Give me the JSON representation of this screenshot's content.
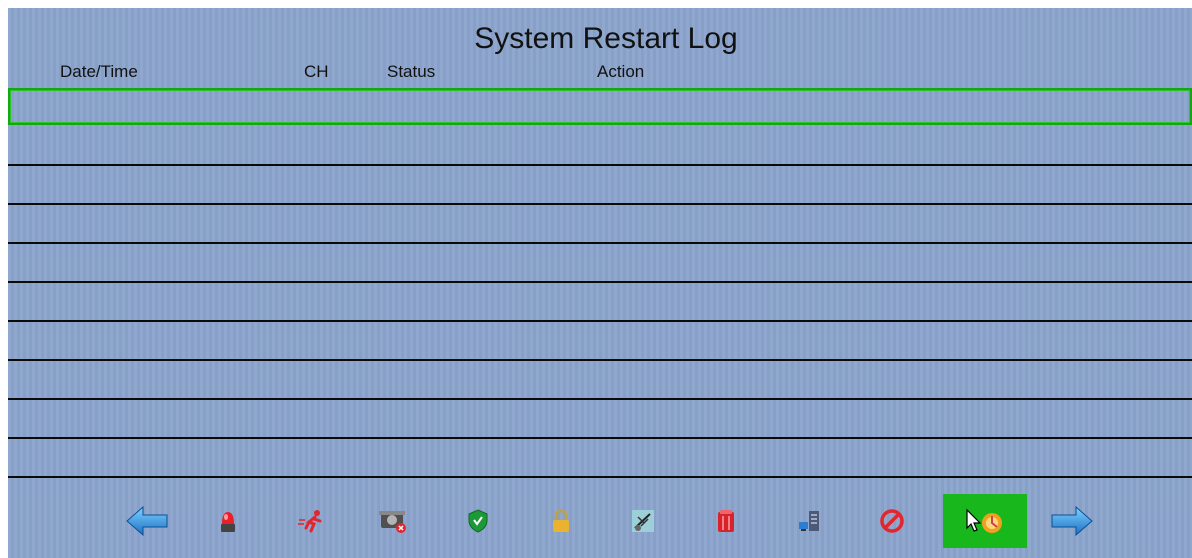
{
  "screen": {
    "title": "System Restart Log"
  },
  "table": {
    "columns": {
      "datetime": "Date/Time",
      "ch": "CH",
      "status": "Status",
      "action": "Action"
    },
    "rows": [
      {
        "datetime": "",
        "ch": "",
        "status": "",
        "action": ""
      },
      {
        "datetime": "",
        "ch": "",
        "status": "",
        "action": ""
      },
      {
        "datetime": "",
        "ch": "",
        "status": "",
        "action": ""
      },
      {
        "datetime": "",
        "ch": "",
        "status": "",
        "action": ""
      },
      {
        "datetime": "",
        "ch": "",
        "status": "",
        "action": ""
      },
      {
        "datetime": "",
        "ch": "",
        "status": "",
        "action": ""
      },
      {
        "datetime": "",
        "ch": "",
        "status": "",
        "action": ""
      },
      {
        "datetime": "",
        "ch": "",
        "status": "",
        "action": ""
      },
      {
        "datetime": "",
        "ch": "",
        "status": "",
        "action": ""
      },
      {
        "datetime": "",
        "ch": "",
        "status": "",
        "action": ""
      }
    ],
    "selected_row": 0
  },
  "toolbar": {
    "items": [
      {
        "icon": "arrow-left-icon"
      },
      {
        "icon": "alarm-light-icon"
      },
      {
        "icon": "motion-run-icon"
      },
      {
        "icon": "camera-error-icon"
      },
      {
        "icon": "shield-check-icon"
      },
      {
        "icon": "lock-icon"
      },
      {
        "icon": "video-loss-icon"
      },
      {
        "icon": "hdd-icon"
      },
      {
        "icon": "network-icon"
      },
      {
        "icon": "prohibited-icon"
      },
      {
        "icon": "system-restart-icon",
        "active": true
      },
      {
        "icon": "arrow-right-icon"
      }
    ]
  },
  "colors": {
    "background": "#8aa3cc",
    "selection": "#15a515",
    "row_line": "#0a0a0a"
  }
}
